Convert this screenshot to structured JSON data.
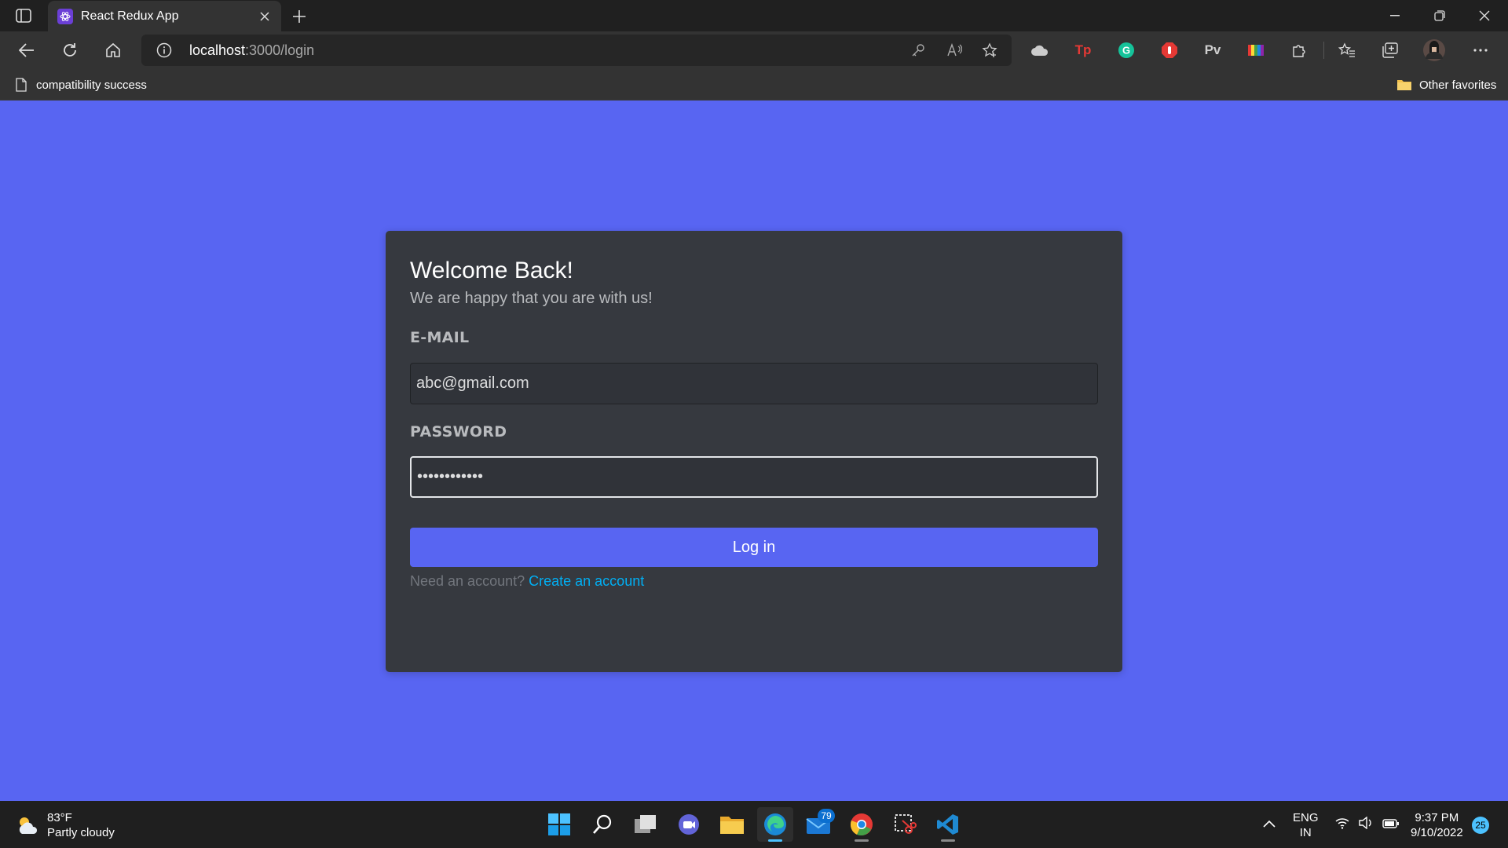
{
  "browser": {
    "tab_title": "React Redux App",
    "url_host": "localhost",
    "url_rest": ":3000/login",
    "favorites_bar": {
      "left_item": "compatibility success",
      "right_item": "Other favorites"
    },
    "extensions": [
      "extensions-cloud",
      "Tp",
      "grammarly",
      "adblock",
      "Pv",
      "color-palette",
      "puzzle"
    ]
  },
  "login": {
    "title": "Welcome Back!",
    "subtitle": "We are happy that you are with us!",
    "email_label": "E-MAIL",
    "email_value": "abc@gmail.com",
    "password_label": "PASSWORD",
    "password_value": "abcdefghijkl",
    "button": "Log in",
    "register_prompt": "Need an account?",
    "register_link": "Create an account"
  },
  "taskbar": {
    "weather_temp": "83°F",
    "weather_desc": "Partly cloudy",
    "mail_badge": "79",
    "lang_1": "ENG",
    "lang_2": "IN",
    "time": "9:37 PM",
    "date": "9/10/2022",
    "notifications": "25"
  },
  "colors": {
    "page_bg": "#5865f2",
    "card_bg": "#36393f",
    "accent": "#5865f2",
    "link": "#00aff4"
  }
}
